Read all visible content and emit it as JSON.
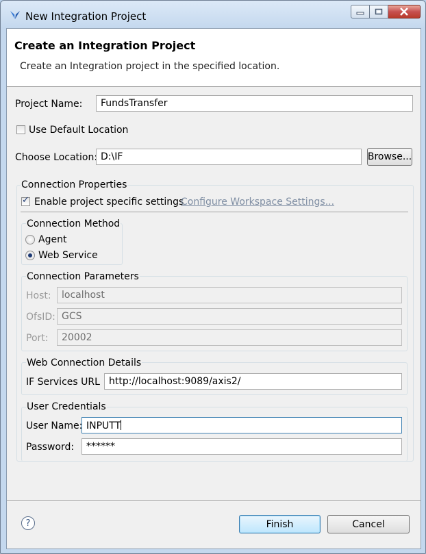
{
  "window": {
    "title": "New Integration Project",
    "icons": {
      "app": "integration-butterfly-icon",
      "minimize": "minimize-icon",
      "maximize": "maximize-icon",
      "close": "close-icon"
    }
  },
  "header": {
    "title": "Create an Integration Project",
    "description": "Create an Integration project in the specified location."
  },
  "form": {
    "project_name_label": "Project Name:",
    "project_name_value": "FundsTransfer",
    "use_default_location_label": "Use Default Location",
    "use_default_location_checked": false,
    "choose_location_label": "Choose Location:",
    "choose_location_value": "D:\\IF",
    "browse_button": "Browse..."
  },
  "connection_properties": {
    "group_title": "Connection Properties",
    "enable_specific_label": "Enable project specific settings",
    "enable_specific_checked": true,
    "configure_link": "Configure Workspace Settings...",
    "method": {
      "group_title": "Connection Method",
      "options": [
        {
          "label": "Agent",
          "selected": false
        },
        {
          "label": "Web Service",
          "selected": true
        }
      ]
    },
    "parameters": {
      "group_title": "Connection Parameters",
      "host_label": "Host:",
      "host_value": "localhost",
      "ofsid_label": "OfsID:",
      "ofsid_value": "GCS",
      "port_label": "Port:",
      "port_value": "20002"
    },
    "web_connection": {
      "group_title": "Web Connection Details",
      "url_label": "IF Services URL :",
      "url_value": "http://localhost:9089/axis2/"
    },
    "credentials": {
      "group_title": "User Credentials",
      "username_label": "User Name:",
      "username_value": "INPUTT",
      "password_label": "Password:",
      "password_value": "******"
    }
  },
  "footer": {
    "help_icon": "help-icon",
    "help_glyph": "?",
    "finish_button": "Finish",
    "cancel_button": "Cancel"
  }
}
